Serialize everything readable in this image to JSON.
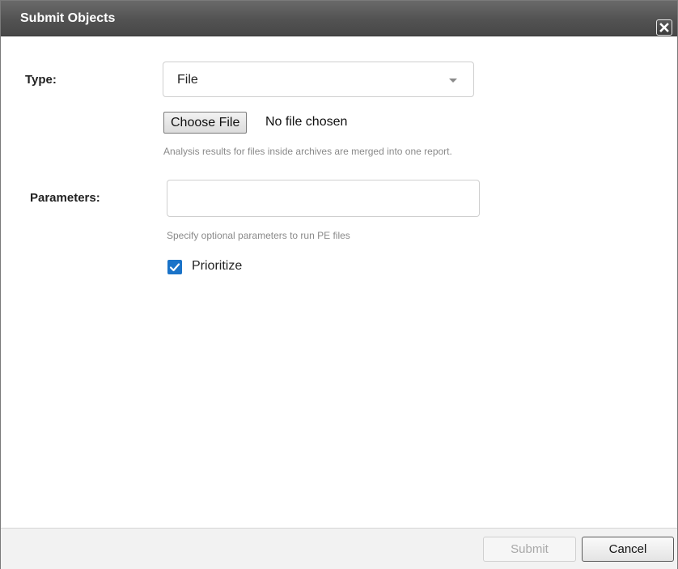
{
  "dialog": {
    "title": "Submit Objects",
    "close_icon": "close-icon"
  },
  "form": {
    "type_label": "Type:",
    "type_value": "File",
    "choose_file_label": "Choose File",
    "file_status": "No file chosen",
    "archive_hint": "Analysis results for files inside archives are merged into one report.",
    "parameters_label": "Parameters:",
    "parameters_value": "",
    "parameters_hint": "Specify optional parameters to run PE files",
    "prioritize_label": "Prioritize",
    "prioritize_checked": true
  },
  "footer": {
    "submit_label": "Submit",
    "submit_enabled": false,
    "cancel_label": "Cancel"
  },
  "colors": {
    "titlebar": "#525252",
    "checkbox_accent": "#1a73c8",
    "hint_text": "#8a8a8a",
    "footer_bg": "#f2f2f2"
  }
}
